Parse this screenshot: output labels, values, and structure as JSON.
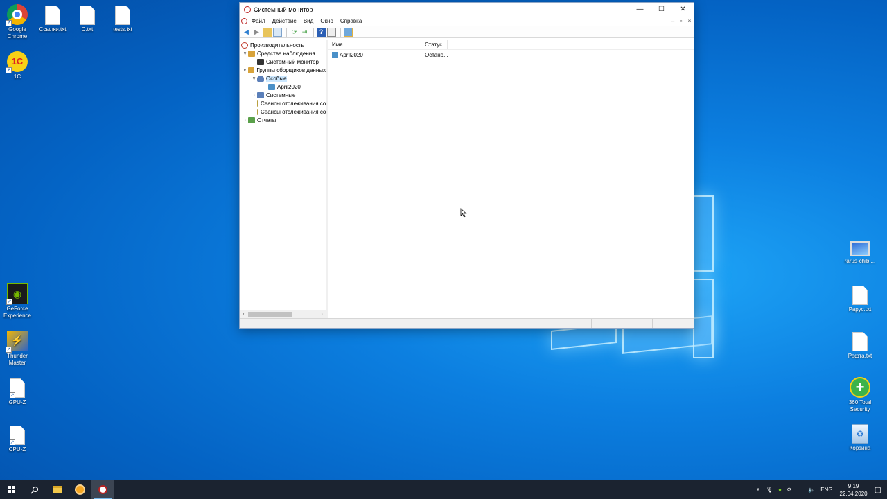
{
  "desktop": {
    "left_icons": [
      {
        "label": "Google Chrome",
        "kind": "chrome"
      },
      {
        "label": "Ссылки.txt",
        "kind": "doc"
      },
      {
        "label": "C.txt",
        "kind": "doc"
      },
      {
        "label": "tests.txt",
        "kind": "doc"
      },
      {
        "label": "1С",
        "kind": "onec"
      },
      {
        "label": "GeForce Experience",
        "kind": "nvidia"
      },
      {
        "label": "Thunder Master",
        "kind": "thunder"
      },
      {
        "label": "GPU-Z",
        "kind": "doc"
      },
      {
        "label": "CPU-Z",
        "kind": "doc"
      }
    ],
    "right_icons": [
      {
        "label": "rarus-chib....",
        "kind": "computer"
      },
      {
        "label": "Рарус.txt",
        "kind": "doc"
      },
      {
        "label": "Рефта.txt",
        "kind": "doc"
      },
      {
        "label": "360 Total Security",
        "kind": "security360"
      },
      {
        "label": "Корзина",
        "kind": "recycle"
      }
    ]
  },
  "window": {
    "title": "Системный монитор",
    "controls": {
      "minimize": "—",
      "maximize": "☐",
      "close": "✕"
    },
    "menu": [
      "Файл",
      "Действие",
      "Вид",
      "Окно",
      "Справка"
    ],
    "mdi_controls": [
      "–",
      "▫",
      "×"
    ],
    "tree": [
      {
        "label": "Производительность",
        "level": 0,
        "expander": "",
        "color": "#c0392b"
      },
      {
        "label": "Средства наблюдения",
        "level": 1,
        "expander": "∨",
        "color": "#d8a33a"
      },
      {
        "label": "Системный монитор",
        "level": 2,
        "expander": "",
        "color": "#333333"
      },
      {
        "label": "Группы сборщиков данных",
        "level": 1,
        "expander": "∨",
        "color": "#d8a33a"
      },
      {
        "label": "Особые",
        "level": 2,
        "expander": "∨",
        "color": "#5b7fb9",
        "selected": true
      },
      {
        "label": "April2020",
        "level": 3,
        "expander": "",
        "color": "#4a90c8"
      },
      {
        "label": "Системные",
        "level": 2,
        "expander": "›",
        "color": "#5b7fb9"
      },
      {
        "label": "Сеансы отслеживания событий",
        "level": 2,
        "expander": "",
        "color": "#e0c870"
      },
      {
        "label": "Сеансы отслеживания событий запуска",
        "level": 2,
        "expander": "",
        "color": "#e0c870"
      },
      {
        "label": "Отчеты",
        "level": 1,
        "expander": "›",
        "color": "#5aa04a"
      }
    ],
    "list": {
      "columns": [
        "Имя",
        "Статус"
      ],
      "rows": [
        {
          "name": "April2020",
          "status": "Остано..."
        }
      ]
    }
  },
  "taskbar": {
    "items": [
      "start-icon",
      "search-icon",
      "file-explorer-icon",
      "app-orange-icon",
      "perfmon-icon"
    ],
    "tray": {
      "lang": "ENG",
      "time": "9:19",
      "date": "22.04.2020"
    }
  }
}
